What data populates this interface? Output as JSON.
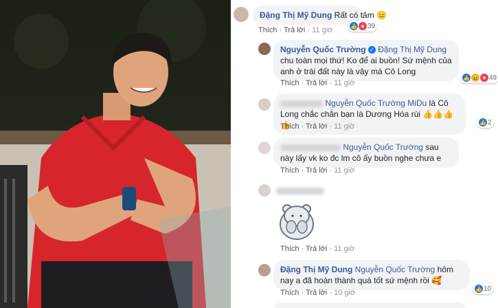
{
  "comments": [
    {
      "author": "Đặng Thị Mỹ Dung",
      "text": "Rất có tâm",
      "emoji": "😑",
      "actions": {
        "like": "Thích",
        "reply": "Trả lời",
        "time": "11 giờ"
      },
      "reactions": {
        "icons": [
          "like-icon",
          "love-icon"
        ],
        "count": "39"
      }
    },
    {
      "author": "Nguyễn Quốc Trường",
      "verified": true,
      "mention": "Đặng Thị Mỹ Dung",
      "text": "chu toàn mọi thứ! Ko để ai buồn! Sứ mệnh của anh ở trái đất này là vậy mà Cô Long",
      "actions": {
        "like": "Thích",
        "reply": "Trả lời",
        "time": "11 giờ"
      },
      "reactions": {
        "icons": [
          "like-icon",
          "haha-icon",
          "love-icon"
        ],
        "count": "49"
      }
    },
    {
      "author_hidden": true,
      "mention": "Nguyễn Quốc Trường MiDu",
      "text": "là Cô Long chắc chắn bạn là Dương Hóa rùi",
      "emoji": "👍👍👍👍",
      "actions": {
        "like": "Thích",
        "reply": "Trả lời",
        "time": "11 giờ"
      },
      "reactions": {
        "icons": [
          "like-icon"
        ],
        "count": "2"
      }
    },
    {
      "author_hidden": true,
      "mention": "Nguyễn Quốc Trường",
      "text": "sau này lấy vk ko đc lm cô ấy buồn nghe chưa e",
      "actions": {
        "like": "Thích",
        "reply": "Trả lời",
        "time": "11 giờ"
      }
    },
    {
      "author_hidden": true,
      "sticker": "bear-sticker",
      "actions": {
        "like": "Thích",
        "reply": "Trả lời",
        "time": "11 giờ"
      }
    },
    {
      "author": "Đặng Thị Mỹ Dung",
      "mention": "Nguyễn Quốc Trường",
      "text": "hôm nay a đã hoàn thành quá tốt sứ mệnh rồi",
      "emoji": "🥰",
      "actions": {
        "like": "Thích",
        "reply": "Trả lời",
        "time": "10 giờ"
      },
      "reactions": {
        "icons": [
          "like-icon"
        ],
        "count": "10"
      }
    }
  ]
}
